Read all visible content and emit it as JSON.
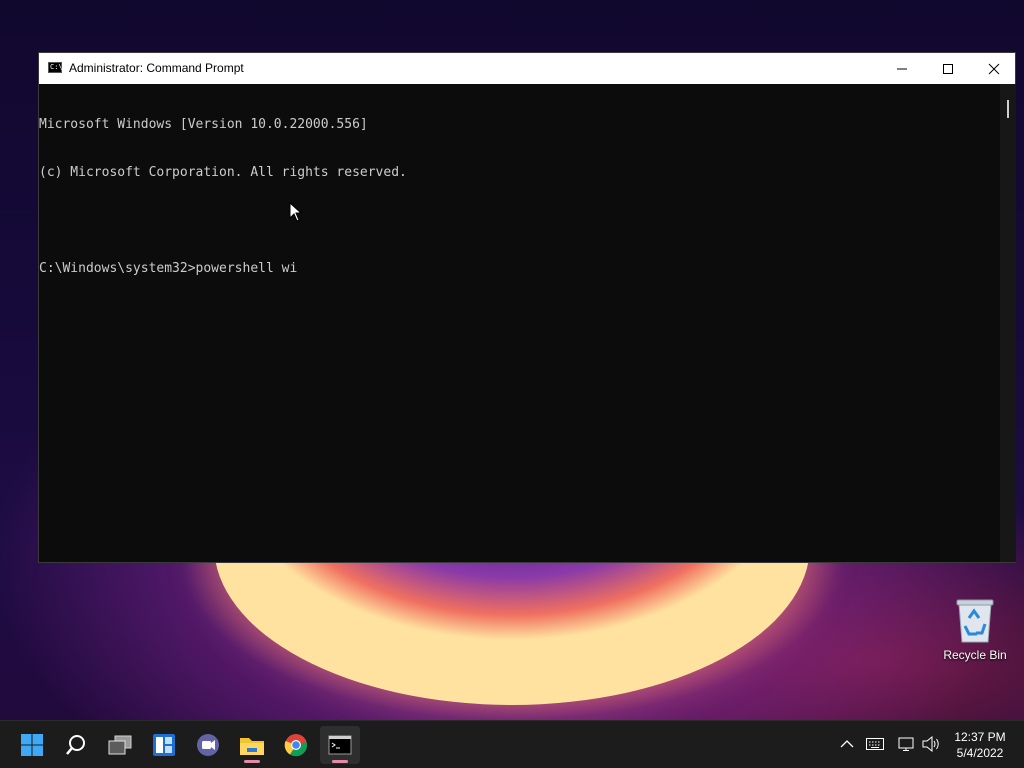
{
  "window": {
    "title": "Administrator: Command Prompt",
    "icon_text": "C:\\"
  },
  "console": {
    "lines": [
      "Microsoft Windows [Version 10.0.22000.556]",
      "(c) Microsoft Corporation. All rights reserved.",
      "",
      "C:\\Windows\\system32>powershell wi"
    ]
  },
  "desktop": {
    "recycle_bin_label": "Recycle Bin"
  },
  "taskbar": {
    "items": [
      "start-icon",
      "search-icon",
      "task-view-icon",
      "widgets-icon",
      "chat-icon",
      "file-explorer-icon",
      "chrome-icon",
      "terminal-icon"
    ]
  },
  "clock": {
    "time": "12:37 PM",
    "date": "5/4/2022"
  },
  "colors": {
    "accent": "#0078d4",
    "indicator": "#e58ba8"
  }
}
